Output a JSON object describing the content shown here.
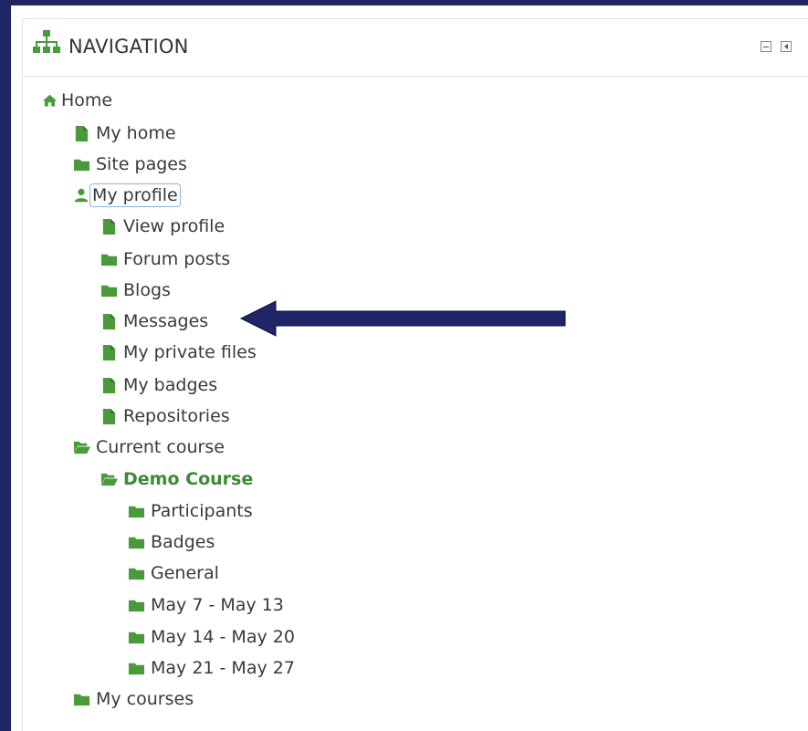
{
  "block": {
    "title": "NAVIGATION",
    "header_icon": "sitemap-icon",
    "controls": [
      {
        "name": "minimize-block",
        "icon": "minus-square-icon"
      },
      {
        "name": "dock-block",
        "icon": "dock-left-icon"
      }
    ]
  },
  "colors": {
    "frame": "#1f2565",
    "icon_green": "#4a9a3c",
    "arrow": "#1f2565",
    "focus": "#8fb2e0"
  },
  "nav": {
    "home": {
      "label": "Home",
      "icon": "home-icon"
    },
    "my_home": {
      "label": "My home",
      "icon": "page-icon"
    },
    "site_pages": {
      "label": "Site pages",
      "icon": "folder-icon"
    },
    "my_profile": {
      "label": "My profile",
      "icon": "user-icon"
    },
    "view_profile": {
      "label": "View profile",
      "icon": "page-icon"
    },
    "forum_posts": {
      "label": "Forum posts",
      "icon": "folder-icon"
    },
    "blogs": {
      "label": "Blogs",
      "icon": "folder-icon"
    },
    "messages": {
      "label": "Messages",
      "icon": "page-icon"
    },
    "private_files": {
      "label": "My private files",
      "icon": "page-icon"
    },
    "badges": {
      "label": "My badges",
      "icon": "page-icon"
    },
    "repositories": {
      "label": "Repositories",
      "icon": "page-icon"
    },
    "current_course": {
      "label": "Current course",
      "icon": "folder-open-icon"
    },
    "demo_course": {
      "label": "Demo Course",
      "icon": "folder-open-icon"
    },
    "participants": {
      "label": "Participants",
      "icon": "folder-icon"
    },
    "course_badges": {
      "label": "Badges",
      "icon": "folder-icon"
    },
    "general": {
      "label": "General",
      "icon": "folder-icon"
    },
    "week1": {
      "label": "May 7 - May 13",
      "icon": "folder-icon"
    },
    "week2": {
      "label": "May 14 - May 20",
      "icon": "folder-icon"
    },
    "week3": {
      "label": "May 21 - May 27",
      "icon": "folder-icon"
    },
    "my_courses": {
      "label": "My courses",
      "icon": "folder-icon"
    }
  },
  "annotation": {
    "icon": "left-arrow-icon"
  }
}
